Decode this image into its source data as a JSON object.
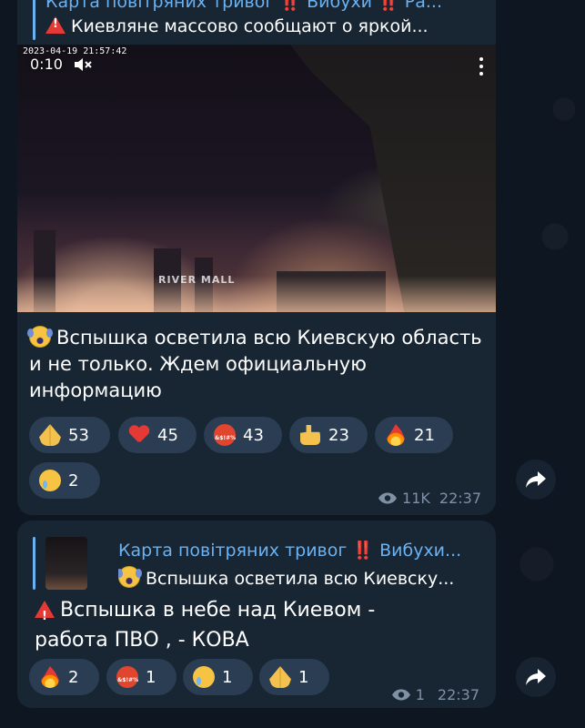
{
  "colors": {
    "background": "#0e1621",
    "bubble": "#182533",
    "reaction_pill": "#2b3d52",
    "accent": "#6ab2f2",
    "meta_text": "#7f91a4"
  },
  "message1": {
    "reply": {
      "title": "Карта повітряних тривог ‼️ Вибухи ‼️ Ра...",
      "icon": "warning-icon",
      "text": "Киевляне массово сообщают о яркой..."
    },
    "video": {
      "timestamp": "2023-04-19 21:57:42",
      "duration": "0:10",
      "muted": true,
      "watermark": "RIVER MALL"
    },
    "text_icon": "face-screaming-icon",
    "text": "Вспышка осветила всю Киевскую область и не только. Ждем официальную информацию",
    "reactions": [
      {
        "icon": "folded-hands-icon",
        "count": "53"
      },
      {
        "icon": "red-heart-icon",
        "count": "45"
      },
      {
        "icon": "cursing-face-icon",
        "count": "43"
      },
      {
        "icon": "thumbs-up-icon",
        "count": "23"
      },
      {
        "icon": "fire-icon",
        "count": "21"
      },
      {
        "icon": "crying-face-icon",
        "count": "2"
      }
    ],
    "views": "11K",
    "time": "22:37"
  },
  "message2": {
    "reply": {
      "title": "Карта повітряних тривог ‼️ Вибухи...",
      "icon": "face-screaming-icon",
      "text": "Вспышка осветила всю Киевску..."
    },
    "text_icon": "warning-icon",
    "text_line1": "Вспышка в небе над Киевом -",
    "text_line2": "работа ПВО , - КОВА",
    "reactions": [
      {
        "icon": "fire-icon",
        "count": "2"
      },
      {
        "icon": "cursing-face-icon",
        "count": "1"
      },
      {
        "icon": "crying-face-icon",
        "count": "1"
      },
      {
        "icon": "folded-hands-icon",
        "count": "1"
      }
    ],
    "views": "1",
    "time": "22:37"
  }
}
